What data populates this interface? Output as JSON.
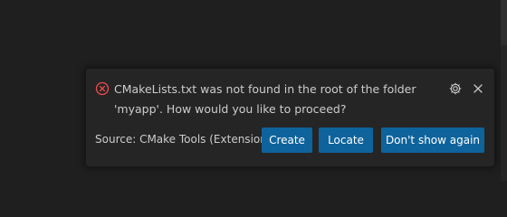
{
  "notification": {
    "severity_icon": "error-circle-icon",
    "message": "CMakeLists.txt was not found in the root of the folder 'myapp'. How would you like to proceed?",
    "source": "Source: CMake Tools (Extension)",
    "actions": {
      "create_label": "Create",
      "locate_label": "Locate",
      "dont_show_label": "Don't show again"
    },
    "settings_icon": "gear-icon",
    "close_icon": "close-icon"
  },
  "colors": {
    "background": "#1f1f1f",
    "toast_background": "#252526",
    "error": "#f14c4c",
    "button": "#0e639c",
    "text": "#cccccc"
  }
}
